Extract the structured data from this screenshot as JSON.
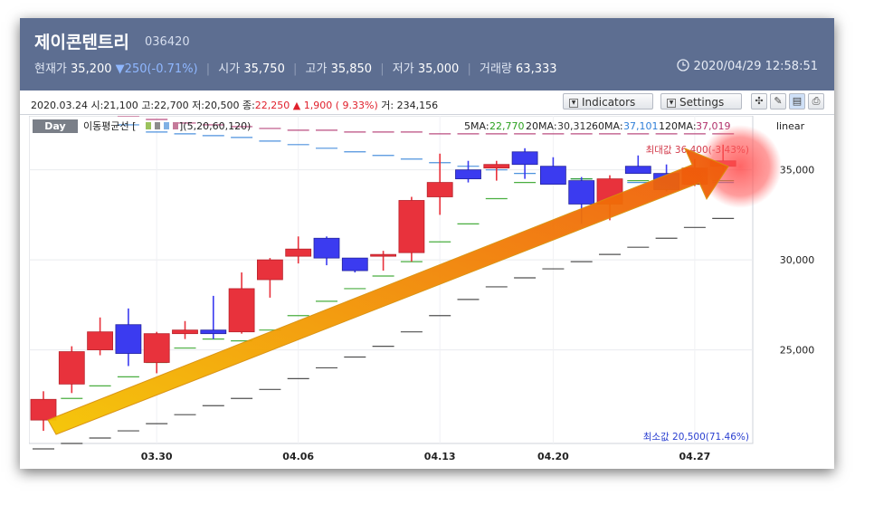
{
  "header": {
    "stock_name": "제이콘텐트리",
    "stock_code": "036420",
    "current_label": "현재가",
    "current_price": "35,200",
    "change": "▼250(-0.71%)",
    "open_label": "시가",
    "open": "35,750",
    "high_label": "고가",
    "high": "35,850",
    "low_label": "저가",
    "low": "35,000",
    "volume_label": "거래량",
    "volume": "63,333",
    "timestamp": "2020/04/29 12:58:51",
    "clock_icon": "clock-icon"
  },
  "toolbar": {
    "info_date": "2020.03.24",
    "info_open": "시:21,100",
    "info_high": "고:22,700",
    "info_low": "저:20,500",
    "info_close_label": "종:",
    "info_close": "22,250",
    "info_change": "▲ 1,900 ( 9.33%)",
    "info_volume": "거: 234,156",
    "indicators_label": "Indicators",
    "settings_label": "Settings",
    "icons": [
      "crosshair-icon",
      "pencil-icon",
      "line-chart-icon",
      "print-icon"
    ]
  },
  "legend": {
    "period": "Day",
    "ma_title": "이동평균선 [",
    "ma_params": "](5,20,60,120)",
    "ma5_label": "5MA:",
    "ma5": "22,770",
    "ma20_label": "20MA:",
    "ma20": "30,312",
    "ma60_label": "60MA:",
    "ma60": "37,101",
    "ma120_label": "120MA:",
    "ma120": "37,019",
    "scale": "linear",
    "max_label": "최대값 36,400(-3.43%)",
    "min_label": "최소값 20,500(71.46%)"
  },
  "colors": {
    "up": "#e8323c",
    "down": "#3b3bf0",
    "ma5": "#2aa01e",
    "ma20": "#333333",
    "ma60": "#2f7fd8",
    "ma120": "#b0306a",
    "header_bg": "#5d6e91",
    "arrow_start": "#f5c400",
    "arrow_end": "#f0580a"
  },
  "chart_data": {
    "type": "candlestick",
    "y_axis": {
      "ticks": [
        25000,
        30000,
        35000
      ]
    },
    "x_ticks": [
      "03.30",
      "04.06",
      "04.13",
      "04.20",
      "04.27"
    ],
    "candles": [
      {
        "o": 21100,
        "h": 22700,
        "l": 20500,
        "c": 22250
      },
      {
        "o": 23100,
        "h": 25200,
        "l": 22600,
        "c": 24900
      },
      {
        "o": 25000,
        "h": 26800,
        "l": 24700,
        "c": 26000
      },
      {
        "o": 26400,
        "h": 27300,
        "l": 24100,
        "c": 24800
      },
      {
        "o": 24300,
        "h": 26000,
        "l": 23700,
        "c": 25900
      },
      {
        "o": 25900,
        "h": 26600,
        "l": 25600,
        "c": 26100
      },
      {
        "o": 26100,
        "h": 28000,
        "l": 25600,
        "c": 25900
      },
      {
        "o": 26000,
        "h": 29300,
        "l": 25900,
        "c": 28400
      },
      {
        "o": 28900,
        "h": 30100,
        "l": 27900,
        "c": 30000
      },
      {
        "o": 30200,
        "h": 31300,
        "l": 29800,
        "c": 30600
      },
      {
        "o": 31200,
        "h": 31300,
        "l": 29700,
        "c": 30100
      },
      {
        "o": 30100,
        "h": 30100,
        "l": 29300,
        "c": 29400
      },
      {
        "o": 30300,
        "h": 30500,
        "l": 29400,
        "c": 30300
      },
      {
        "o": 30400,
        "h": 33500,
        "l": 29900,
        "c": 33300
      },
      {
        "o": 33500,
        "h": 35900,
        "l": 32500,
        "c": 34300
      },
      {
        "o": 35000,
        "h": 35500,
        "l": 34300,
        "c": 34500
      },
      {
        "o": 35100,
        "h": 35500,
        "l": 34400,
        "c": 35300
      },
      {
        "o": 36000,
        "h": 36200,
        "l": 34500,
        "c": 35300
      },
      {
        "o": 35200,
        "h": 35700,
        "l": 34200,
        "c": 34200
      },
      {
        "o": 34400,
        "h": 34600,
        "l": 32000,
        "c": 33100
      },
      {
        "o": 33100,
        "h": 34700,
        "l": 32200,
        "c": 34500
      },
      {
        "o": 35200,
        "h": 35800,
        "l": 34800,
        "c": 34800
      },
      {
        "o": 34800,
        "h": 35300,
        "l": 33800,
        "c": 33900
      },
      {
        "o": 34200,
        "h": 35600,
        "l": 34100,
        "c": 35100
      },
      {
        "o": 35200,
        "h": 36400,
        "l": 35000,
        "c": 35500
      }
    ],
    "ma5": [
      21700,
      22300,
      23000,
      23500,
      24300,
      25100,
      25600,
      25500,
      26100,
      26900,
      27700,
      28400,
      29100,
      29900,
      31000,
      32000,
      33400,
      34300,
      34700,
      34500,
      34400,
      34400,
      34300,
      34200,
      34400
    ],
    "ma20": [
      19500,
      19800,
      20100,
      20500,
      20900,
      21400,
      21900,
      22300,
      22800,
      23400,
      24000,
      24600,
      25200,
      26000,
      26900,
      27800,
      28500,
      29000,
      29500,
      29900,
      30300,
      30700,
      31200,
      31800,
      32300
    ],
    "ma60": [
      39500,
      38900,
      38100,
      37500,
      37100,
      37000,
      36900,
      36800,
      36600,
      36400,
      36200,
      36000,
      35800,
      35600,
      35400,
      35200,
      35000,
      34800,
      34600,
      34500,
      34400,
      34300,
      34200,
      34200,
      34300
    ],
    "ma120": [
      39000,
      38800,
      38300,
      38000,
      37800,
      37600,
      37500,
      37400,
      37300,
      37200,
      37200,
      37100,
      37100,
      37100,
      37000,
      37000,
      37000,
      37000,
      37000,
      37000,
      37000,
      37000,
      37000,
      37000,
      37000
    ]
  }
}
